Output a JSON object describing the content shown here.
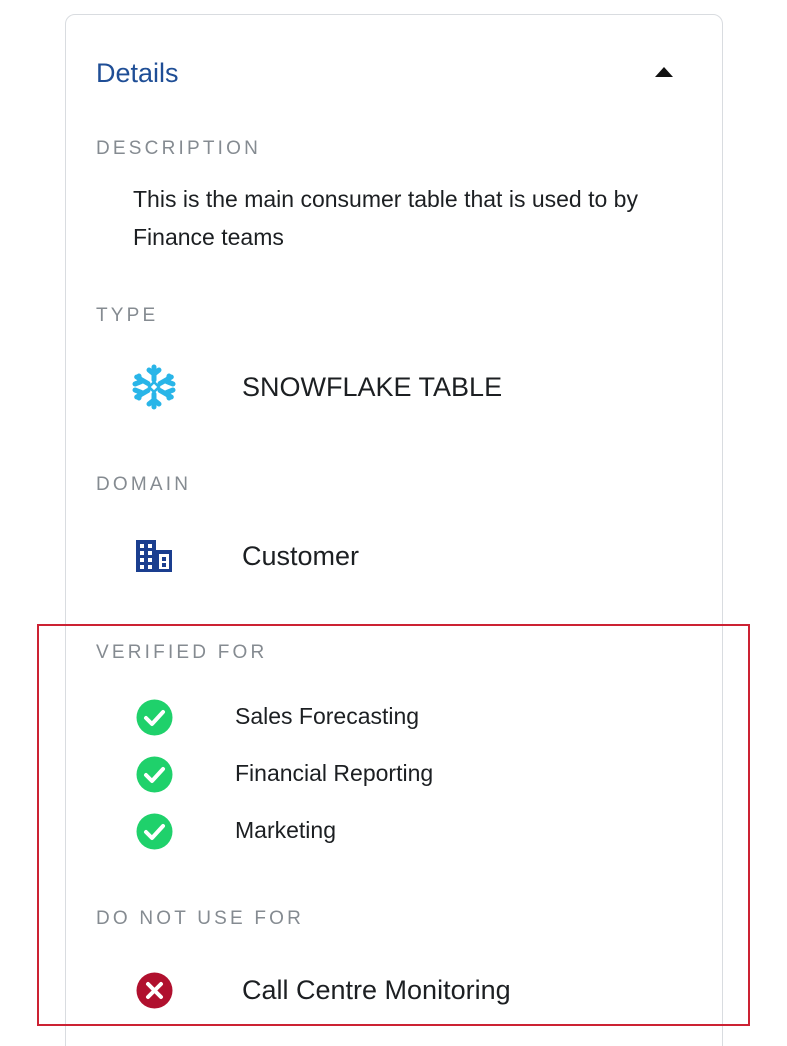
{
  "details": {
    "title": "Details",
    "toggle_icon": "caret-up-icon"
  },
  "description": {
    "label": "DESCRIPTION",
    "text": "This is the main consumer table that is used to by Finance teams"
  },
  "type": {
    "label": "TYPE",
    "value": "SNOWFLAKE TABLE",
    "icon": "snowflake-icon",
    "icon_color": "#29b5e8"
  },
  "domain": {
    "label": "DOMAIN",
    "value": "Customer",
    "icon": "building-icon",
    "icon_color": "#1a3e8f"
  },
  "verified_for": {
    "label": "VERIFIED FOR",
    "icon": "check-circle-icon",
    "icon_color": "#1fd16b",
    "items": [
      "Sales Forecasting",
      "Financial Reporting",
      "Marketing"
    ]
  },
  "do_not_use_for": {
    "label": "DO NOT USE FOR",
    "icon": "x-circle-icon",
    "icon_color": "#b0102e",
    "items": [
      "Call Centre Monitoring"
    ]
  },
  "colors": {
    "title": "#1f4e96",
    "label": "#858b91",
    "text": "#1c1f22",
    "card_border": "#d9dce0",
    "highlight_border": "#cc2233"
  }
}
